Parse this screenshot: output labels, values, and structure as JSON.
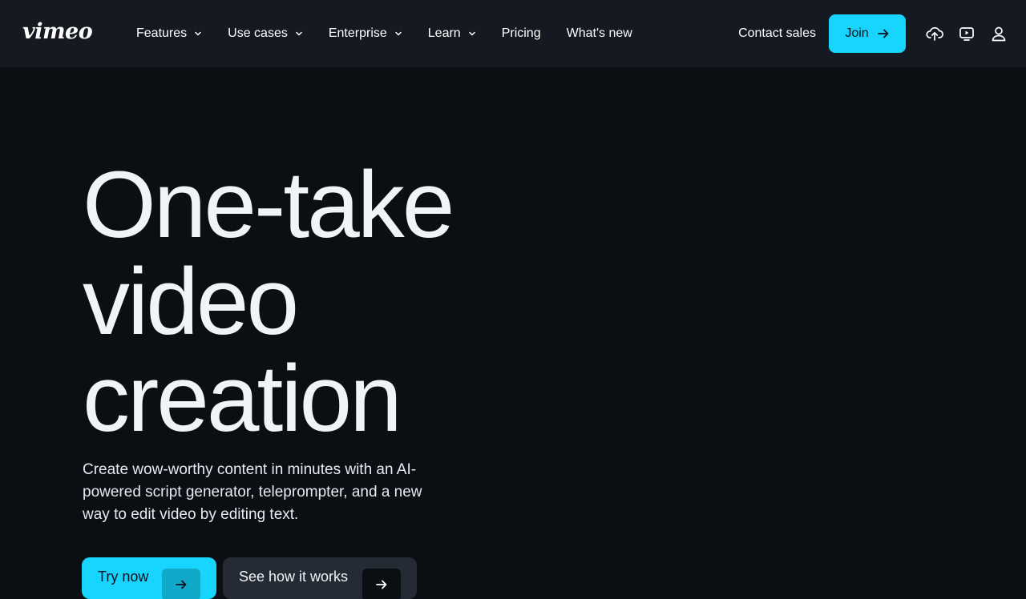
{
  "header": {
    "logo": "vimeo",
    "nav": [
      {
        "label": "Features",
        "dropdown": true
      },
      {
        "label": "Use cases",
        "dropdown": true
      },
      {
        "label": "Enterprise",
        "dropdown": true
      },
      {
        "label": "Learn",
        "dropdown": true
      },
      {
        "label": "Pricing",
        "dropdown": false
      },
      {
        "label": "What's new",
        "dropdown": false
      }
    ],
    "contact_label": "Contact sales",
    "join_label": "Join",
    "icons": [
      "upload-icon",
      "video-library-icon",
      "user-icon"
    ]
  },
  "hero": {
    "title_lines": [
      "One-take",
      "video",
      "creation"
    ],
    "subtitle": "Create wow-worthy content in minutes with an AI-powered script generator, teleprompter, and a new way to edit video by editing text.",
    "cta_primary": "Try now",
    "cta_secondary": "See how it works"
  },
  "colors": {
    "background": "#0b0e13",
    "header_bg": "#151a22",
    "accent": "#17d5ff",
    "text": "#f0f3f8"
  }
}
